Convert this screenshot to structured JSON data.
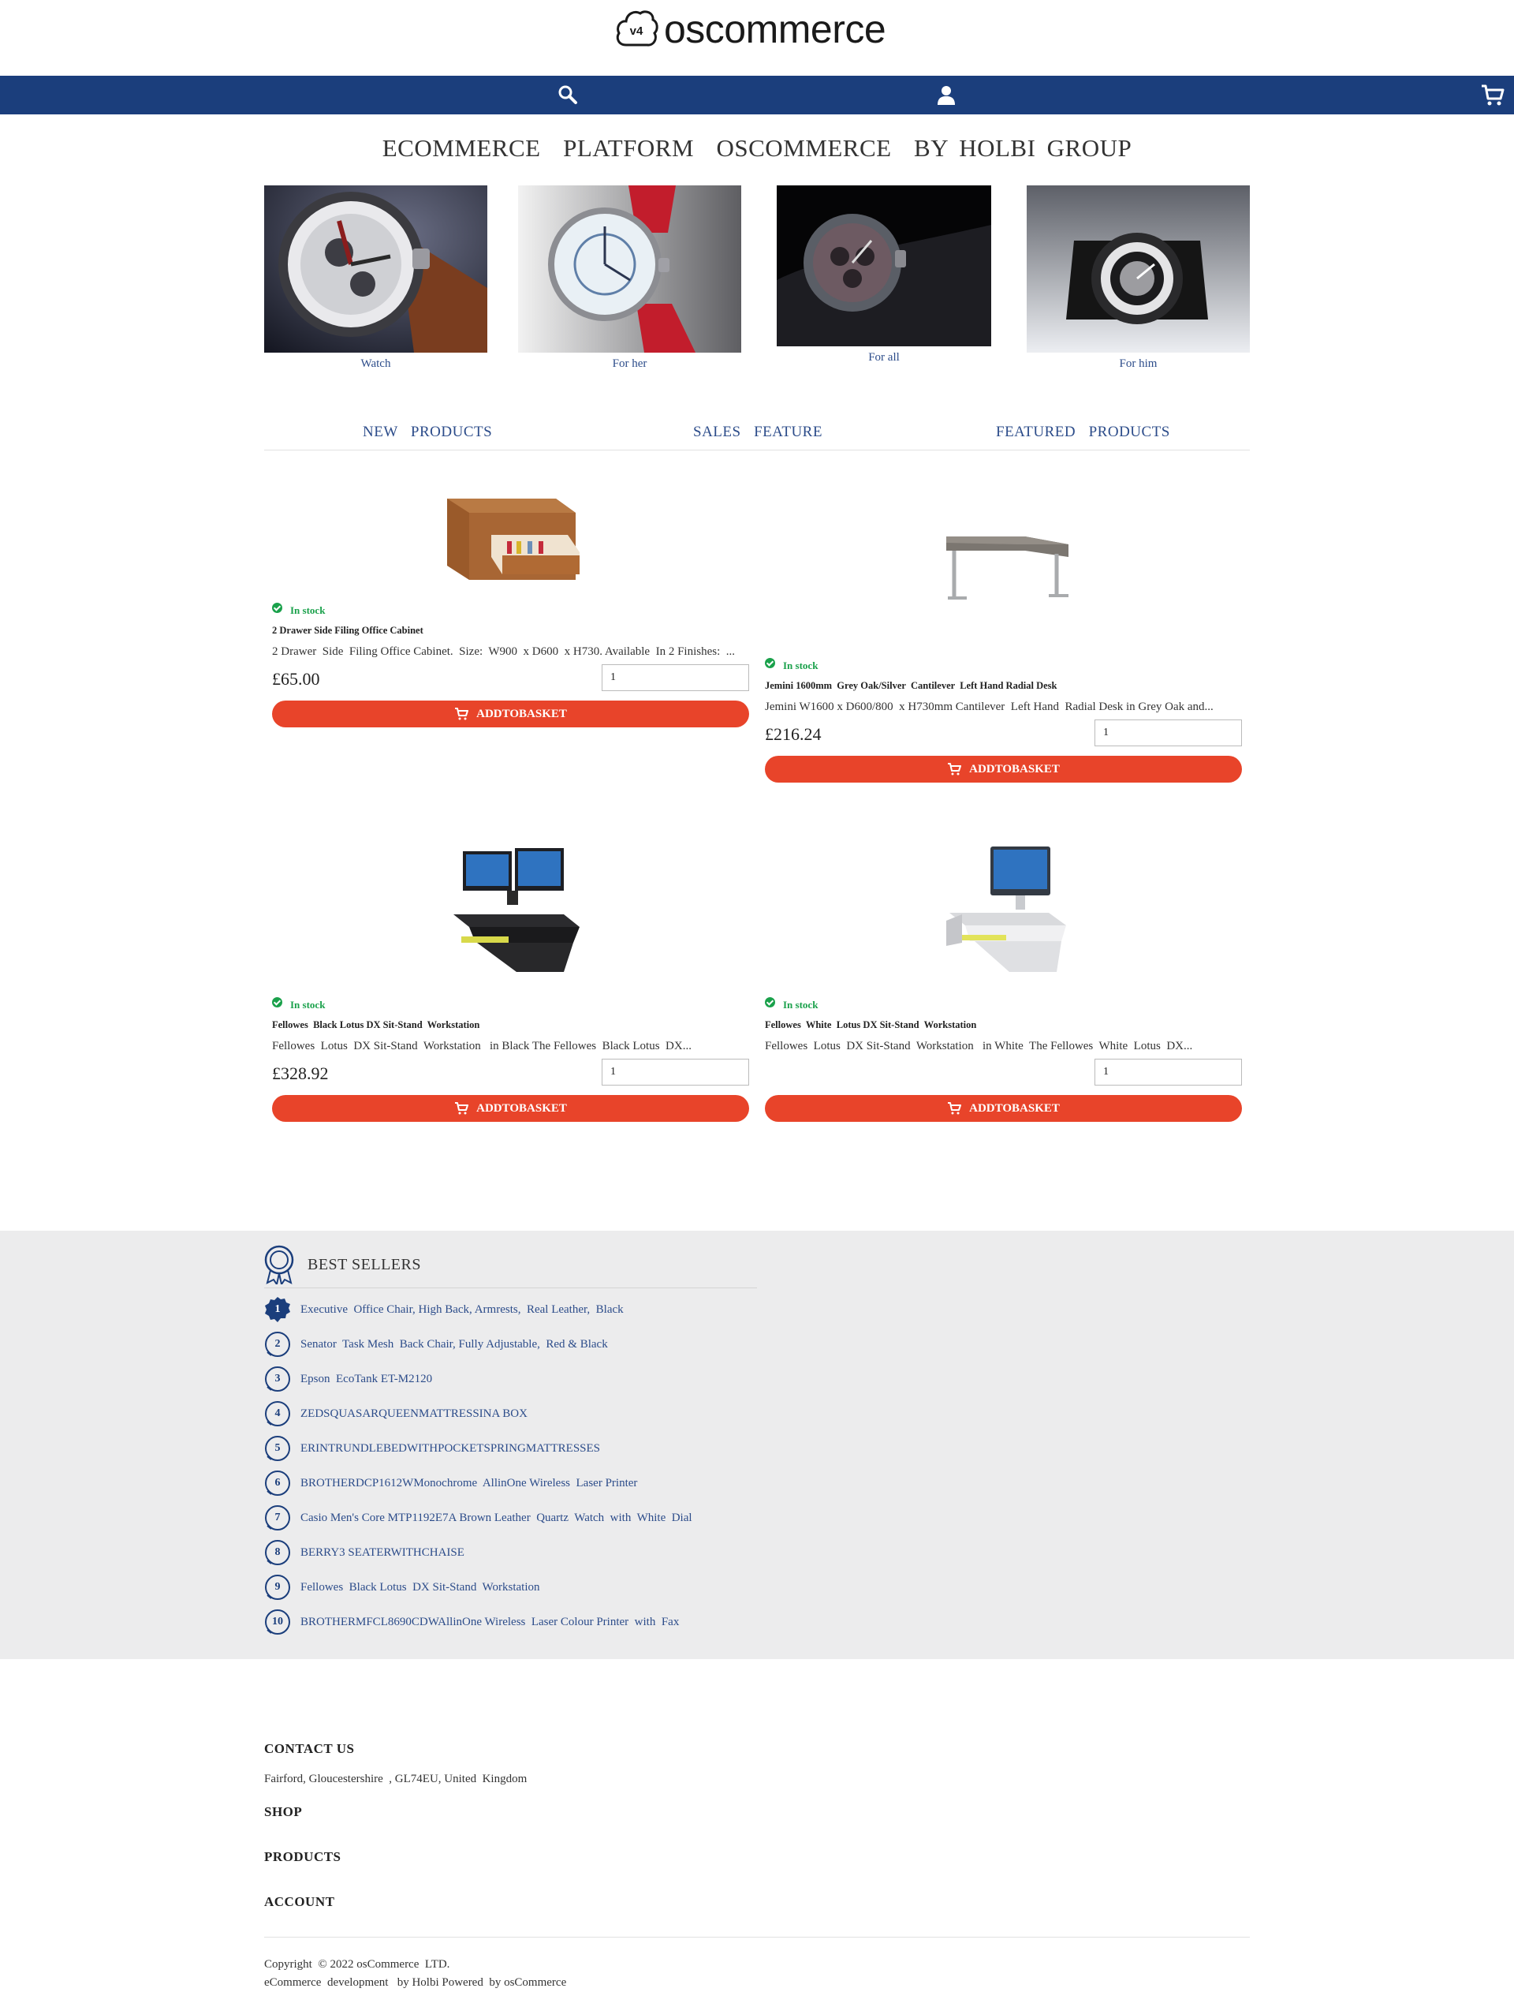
{
  "brand": {
    "badge": "v4",
    "name": "oscommerce"
  },
  "colors": {
    "nav": "#1b3e7c",
    "link": "#2c4c8a",
    "accent": "#e8442a",
    "stock": "#1aa14b",
    "band": "#ececed"
  },
  "nav": {
    "icons": [
      "search-icon",
      "user-icon",
      "cart-icon"
    ]
  },
  "headline": "ECOMMERCE  PLATFORM  OSCOMMERCE  BY HOLBI GROUP",
  "categories": [
    {
      "label": "Watch"
    },
    {
      "label": "For her"
    },
    {
      "label": "For all"
    },
    {
      "label": "For him"
    }
  ],
  "tabs": [
    "NEW  PRODUCTS",
    "SALES  FEATURE",
    "FEATURED  PRODUCTS"
  ],
  "products": [
    {
      "stock": "In stock",
      "name": "2 Drawer Side Filing Office Cabinet",
      "desc": "2 Drawer  Side  Filing Office Cabinet.  Size:  W900  x D600  x H730. Available  In 2 Finishes:  ...",
      "price": "£65.00",
      "qty": "1",
      "button": "ADDTOBASKET"
    },
    {
      "stock": "In stock",
      "name": "Jemini 1600mm  Grey Oak/Silver  Cantilever  Left Hand Radial Desk",
      "desc": "Jemini W1600 x D600/800  x H730mm Cantilever  Left Hand  Radial Desk in Grey Oak and...",
      "price": "£216.24",
      "qty": "1",
      "button": "ADDTOBASKET"
    },
    {
      "stock": "In stock",
      "name": "Fellowes  Black Lotus DX Sit-Stand  Workstation",
      "desc": "Fellowes  Lotus  DX Sit-Stand  Workstation   in Black The Fellowes  Black Lotus  DX...",
      "price": "£328.92",
      "qty": "1",
      "button": "ADDTOBASKET"
    },
    {
      "stock": "In stock",
      "name": "Fellowes  White  Lotus DX Sit-Stand  Workstation",
      "desc": "Fellowes  Lotus  DX Sit-Stand  Workstation   in White  The Fellowes  White  Lotus  DX...",
      "price": "",
      "qty": "1",
      "button": "ADDTOBASKET"
    }
  ],
  "best_sellers": {
    "title": "BEST SELLERS",
    "items": [
      {
        "n": "1",
        "label": "Executive  Office Chair, High Back, Armrests,  Real Leather,  Black"
      },
      {
        "n": "2",
        "label": "Senator  Task Mesh  Back Chair, Fully Adjustable,  Red & Black"
      },
      {
        "n": "3",
        "label": "Epson  EcoTank ET-M2120"
      },
      {
        "n": "4",
        "label": "ZEDSQUASARQUEENMATTRESSINA BOX"
      },
      {
        "n": "5",
        "label": "ERINTRUNDLEBEDWITHPOCKETSPRINGMATTRESSES"
      },
      {
        "n": "6",
        "label": "BROTHERDCP1612WMonochrome  AllinOne Wireless  Laser Printer"
      },
      {
        "n": "7",
        "label": "Casio Men's Core MTP1192E7A Brown Leather  Quartz  Watch  with  White  Dial"
      },
      {
        "n": "8",
        "label": "BERRY3 SEATERWITHCHAISE"
      },
      {
        "n": "9",
        "label": "Fellowes  Black Lotus  DX Sit-Stand  Workstation"
      },
      {
        "n": "10",
        "label": "BROTHERMFCL8690CDWAllinOne Wireless  Laser Colour Printer  with  Fax"
      }
    ]
  },
  "footer": {
    "contact_title": "CONTACT US",
    "address": "Fairford, Gloucestershire  , GL74EU, United  Kingdom",
    "shop": "SHOP",
    "products": "PRODUCTS",
    "account": "ACCOUNT",
    "copyright": "Copyright  © 2022 osCommerce  LTD.",
    "powered": "eCommerce  development   by Holbi Powered  by osCommerce"
  }
}
